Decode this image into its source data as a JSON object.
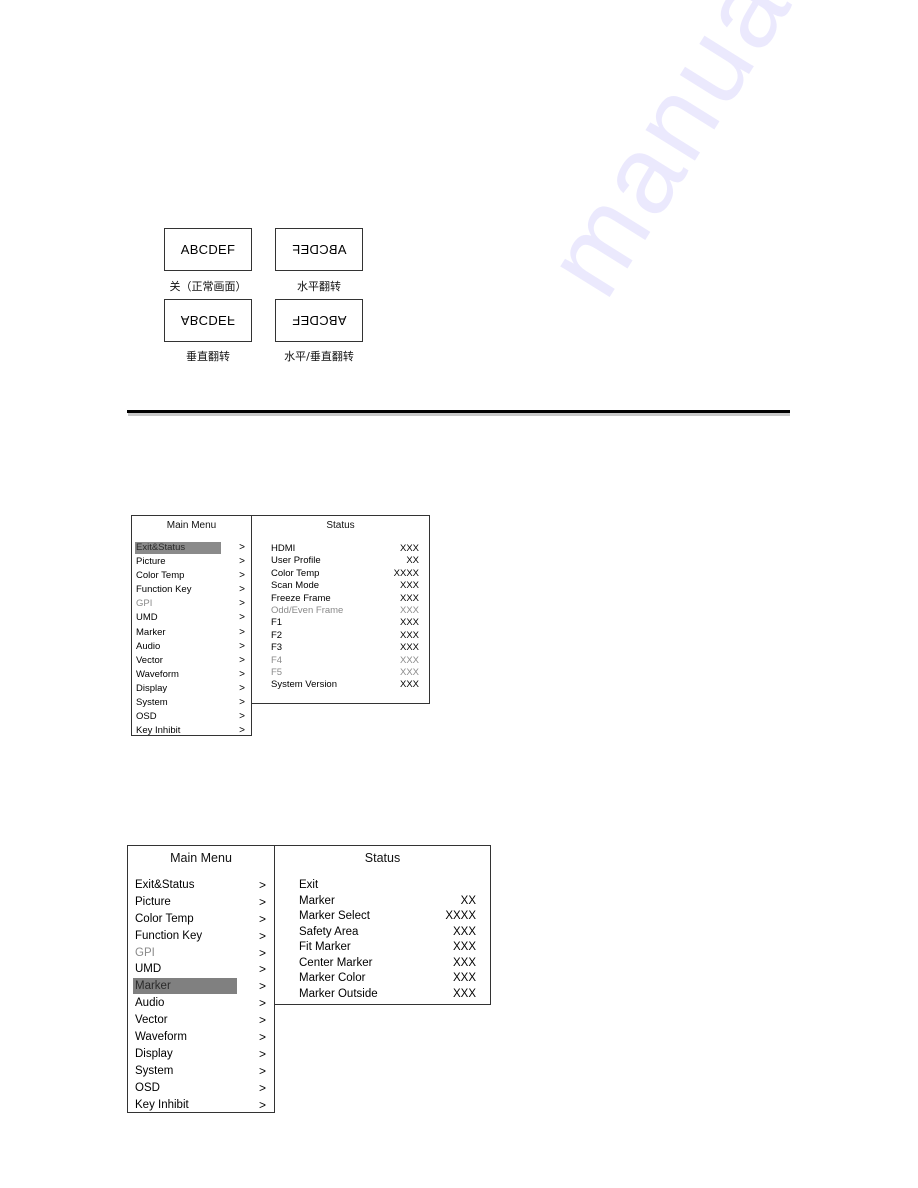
{
  "flip_examples": {
    "sample_text": "ABCDEF",
    "items": [
      {
        "mode": "normal",
        "caption": "关（正常画面）"
      },
      {
        "mode": "horizontal",
        "caption": "水平翻转"
      },
      {
        "mode": "vertical",
        "caption": "垂直翻转"
      },
      {
        "mode": "horizontal-vertical",
        "caption": "水平/垂直翻转"
      }
    ]
  },
  "watermark": "manualslib.com",
  "screen1": {
    "main_menu": {
      "title": "Main Menu",
      "selected_index": 0,
      "items": [
        {
          "label": "Exit&Status",
          "arrow": ">",
          "disabled": false
        },
        {
          "label": "Picture",
          "arrow": ">",
          "disabled": false
        },
        {
          "label": "Color Temp",
          "arrow": ">",
          "disabled": false
        },
        {
          "label": "Function Key",
          "arrow": ">",
          "disabled": false
        },
        {
          "label": "GPI",
          "arrow": ">",
          "disabled": true
        },
        {
          "label": "UMD",
          "arrow": ">",
          "disabled": false
        },
        {
          "label": "Marker",
          "arrow": ">",
          "disabled": false
        },
        {
          "label": "Audio",
          "arrow": ">",
          "disabled": false
        },
        {
          "label": "Vector",
          "arrow": ">",
          "disabled": false
        },
        {
          "label": "Waveform",
          "arrow": ">",
          "disabled": false
        },
        {
          "label": "Display",
          "arrow": ">",
          "disabled": false
        },
        {
          "label": "System",
          "arrow": ">",
          "disabled": false
        },
        {
          "label": "OSD",
          "arrow": ">",
          "disabled": false
        },
        {
          "label": "Key Inhibit",
          "arrow": ">",
          "disabled": false
        }
      ]
    },
    "status": {
      "title": "Status",
      "rows": [
        {
          "label": "HDMI",
          "value": "XXX",
          "disabled": false
        },
        {
          "label": "User Profile",
          "value": "XX",
          "disabled": false
        },
        {
          "label": "Color Temp",
          "value": "XXXX",
          "disabled": false
        },
        {
          "label": "Scan Mode",
          "value": "XXX",
          "disabled": false
        },
        {
          "label": "Freeze Frame",
          "value": "XXX",
          "disabled": false
        },
        {
          "label": "Odd/Even Frame",
          "value": "XXX",
          "disabled": true
        },
        {
          "label": "F1",
          "value": "XXX",
          "disabled": false
        },
        {
          "label": "F2",
          "value": "XXX",
          "disabled": false
        },
        {
          "label": "F3",
          "value": "XXX",
          "disabled": false
        },
        {
          "label": "F4",
          "value": "XXX",
          "disabled": true
        },
        {
          "label": "F5",
          "value": "XXX",
          "disabled": true
        },
        {
          "label": "System Version",
          "value": "XXX",
          "disabled": false
        }
      ]
    }
  },
  "screen2": {
    "main_menu": {
      "title": "Main Menu",
      "selected_index": 6,
      "items": [
        {
          "label": "Exit&Status",
          "arrow": ">",
          "disabled": false
        },
        {
          "label": "Picture",
          "arrow": ">",
          "disabled": false
        },
        {
          "label": "Color Temp",
          "arrow": ">",
          "disabled": false
        },
        {
          "label": "Function Key",
          "arrow": ">",
          "disabled": false
        },
        {
          "label": "GPI",
          "arrow": ">",
          "disabled": true
        },
        {
          "label": "UMD",
          "arrow": ">",
          "disabled": false
        },
        {
          "label": "Marker",
          "arrow": ">",
          "disabled": false
        },
        {
          "label": "Audio",
          "arrow": ">",
          "disabled": false
        },
        {
          "label": "Vector",
          "arrow": ">",
          "disabled": false
        },
        {
          "label": "Waveform",
          "arrow": ">",
          "disabled": false
        },
        {
          "label": "Display",
          "arrow": ">",
          "disabled": false
        },
        {
          "label": "System",
          "arrow": ">",
          "disabled": false
        },
        {
          "label": "OSD",
          "arrow": ">",
          "disabled": false
        },
        {
          "label": "Key Inhibit",
          "arrow": ">",
          "disabled": false
        }
      ]
    },
    "status": {
      "title": "Status",
      "rows": [
        {
          "label": "Exit",
          "value": "",
          "disabled": false
        },
        {
          "label": "Marker",
          "value": "XX",
          "disabled": false
        },
        {
          "label": "Marker Select",
          "value": "XXXX",
          "disabled": false
        },
        {
          "label": "Safety Area",
          "value": "XXX",
          "disabled": false
        },
        {
          "label": "Fit Marker",
          "value": "XXX",
          "disabled": false
        },
        {
          "label": "Center Marker",
          "value": "XXX",
          "disabled": false
        },
        {
          "label": "Marker Color",
          "value": "XXX",
          "disabled": false
        },
        {
          "label": "Marker Outside",
          "value": "XXX",
          "disabled": false
        }
      ]
    }
  },
  "colors": {
    "highlight": "#808080",
    "disabled_text": "#8a8a8a",
    "border": "#333333"
  }
}
